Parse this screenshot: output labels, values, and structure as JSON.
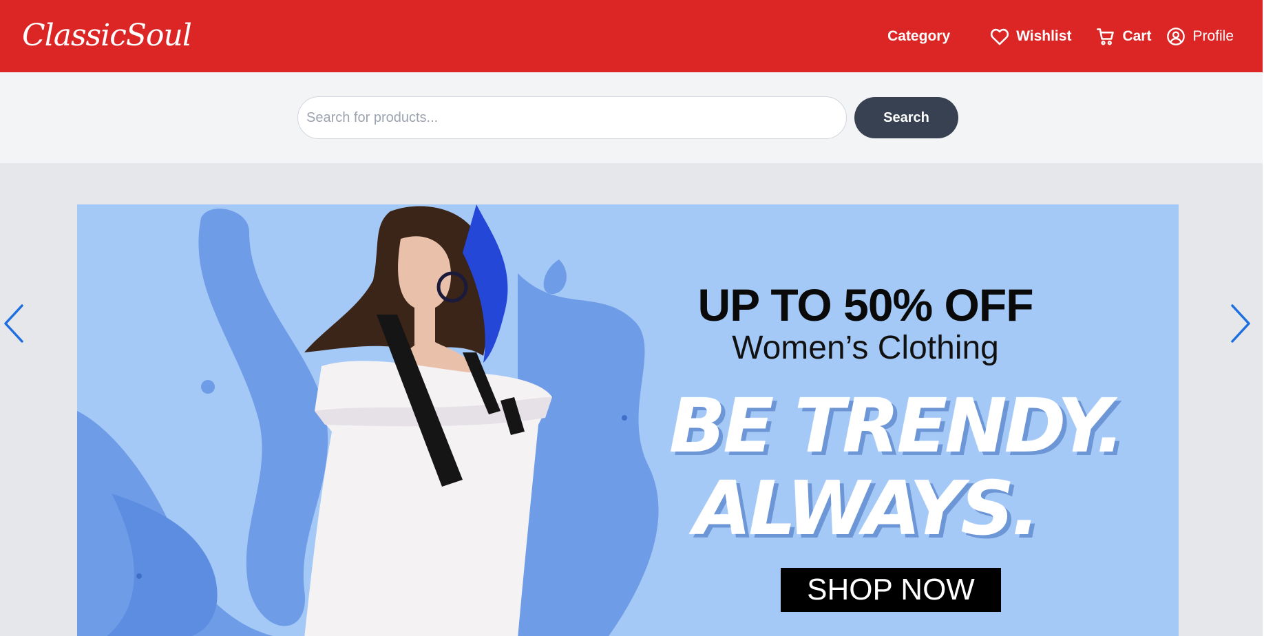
{
  "brand": {
    "name": "ClassicSoul"
  },
  "nav": {
    "category": "Category",
    "wishlist": "Wishlist",
    "cart": "Cart",
    "profile": "Profile"
  },
  "search": {
    "placeholder": "Search for products...",
    "button_label": "Search"
  },
  "banner": {
    "headline": "UP TO 50% OFF",
    "subheadline": "Women’s Clothing",
    "tagline_1": "BE TRENDY.",
    "tagline_2": "ALWAYS.",
    "cta": "SHOP NOW"
  },
  "icons": {
    "wishlist": "heart-icon",
    "cart": "cart-icon",
    "profile": "user-circle-icon",
    "prev": "chevron-left-icon",
    "next": "chevron-right-icon"
  },
  "colors": {
    "header": "#dc2626",
    "search_band": "#f3f4f6",
    "page_bg": "#e5e7eb",
    "search_button": "#374151",
    "banner_bg": "#a4c9f7",
    "carousel_arrow": "#1d6fe0"
  }
}
